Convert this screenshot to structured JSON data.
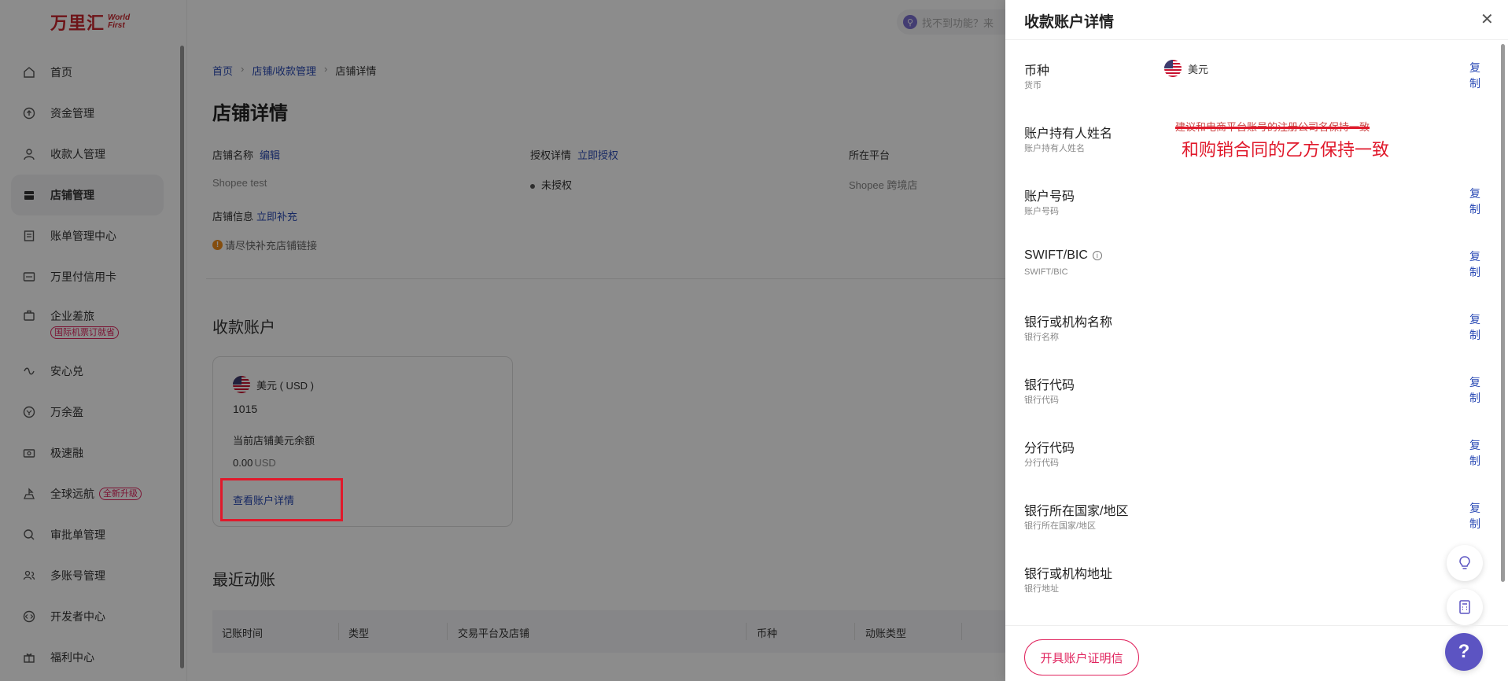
{
  "app": {
    "logo_cn": "万里汇",
    "logo_en1": "World",
    "logo_en2": "First"
  },
  "sidebar": {
    "items": [
      {
        "label": "首页",
        "icon": "home-icon"
      },
      {
        "label": "资金管理",
        "icon": "funds-icon"
      },
      {
        "label": "收款人管理",
        "icon": "payee-icon"
      },
      {
        "label": "店铺管理",
        "icon": "store-icon",
        "active": true
      },
      {
        "label": "账单管理中心",
        "icon": "bill-icon"
      },
      {
        "label": "万里付信用卡",
        "icon": "card-icon"
      },
      {
        "label": "企业差旅",
        "icon": "travel-icon",
        "badge": "国际机票订就省"
      },
      {
        "label": "安心兑",
        "icon": "exchange-icon"
      },
      {
        "label": "万余盈",
        "icon": "yield-icon"
      },
      {
        "label": "极速融",
        "icon": "finance-icon"
      },
      {
        "label": "全球远航",
        "icon": "global-icon",
        "badge": "全新升级"
      },
      {
        "label": "审批单管理",
        "icon": "approval-icon"
      },
      {
        "label": "多账号管理",
        "icon": "accounts-icon"
      },
      {
        "label": "开发者中心",
        "icon": "developer-icon"
      },
      {
        "label": "福利中心",
        "icon": "gift-icon"
      }
    ]
  },
  "search": {
    "placeholder": "找不到功能？来"
  },
  "breadcrumb": {
    "home": "首页",
    "parent": "店铺/收款管理",
    "current": "店铺详情"
  },
  "page": {
    "title": "店铺详情",
    "store_name_label": "店铺名称",
    "store_name_edit": "编辑",
    "store_name": "Shopee test",
    "auth_label": "授权详情",
    "auth_link": "立即授权",
    "auth_status": "未授权",
    "platform_label": "所在平台",
    "platform": "Shopee 跨境店",
    "info_label": "店铺信息",
    "info_link": "立即补充",
    "warning": "请尽快补充店铺链接"
  },
  "receiving": {
    "title": "收款账户",
    "currency": "美元 ( USD )",
    "account": "1015",
    "balance_label": "当前店铺美元余额",
    "balance": "0.00",
    "balance_unit": "USD",
    "view_details": "查看账户详情"
  },
  "recent": {
    "title": "最近动账",
    "columns": [
      "记账时间",
      "类型",
      "交易平台及店铺",
      "币种",
      "动账类型"
    ]
  },
  "drawer": {
    "title": "收款账户详情",
    "copy": "复制",
    "currency_value": "美元",
    "strike_note": "建议和电商平台账号的注册公司名保持一致",
    "red_note": "和购销合同的乙方保持一致",
    "rows": [
      {
        "label": "币种",
        "sub": "货币"
      },
      {
        "label": "账户持有人姓名",
        "sub": "账户持有人姓名"
      },
      {
        "label": "账户号码",
        "sub": "账户号码"
      },
      {
        "label": "SWIFT/BIC",
        "sub": "SWIFT/BIC"
      },
      {
        "label": "银行或机构名称",
        "sub": "银行名称"
      },
      {
        "label": "银行代码",
        "sub": "银行代码"
      },
      {
        "label": "分行代码",
        "sub": "分行代码"
      },
      {
        "label": "银行所在国家/地区",
        "sub": "银行所在国家/地区"
      },
      {
        "label": "银行或机构地址",
        "sub": "银行地址"
      }
    ],
    "cert_button": "开具账户证明信"
  },
  "colors": {
    "accent": "#2b4bb5",
    "brand": "#c9252c",
    "pink": "#e0245e",
    "annotation": "#e0192b"
  }
}
